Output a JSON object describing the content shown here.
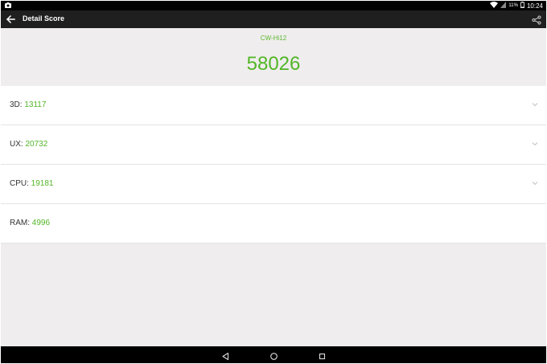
{
  "status_bar": {
    "battery_percent": "11%",
    "time": "10:24"
  },
  "app_bar": {
    "title": "Detail Score"
  },
  "header": {
    "device_name": "CW-Hi12",
    "total_score": "58026"
  },
  "scores": [
    {
      "label": "3D: ",
      "value": "13117",
      "expandable": true
    },
    {
      "label": "UX: ",
      "value": "20732",
      "expandable": true
    },
    {
      "label": "CPU: ",
      "value": "19181",
      "expandable": true
    },
    {
      "label": "RAM: ",
      "value": "4996",
      "expandable": false
    }
  ],
  "colors": {
    "accent": "#52b627",
    "app_bar": "#1f1f1f",
    "background": "#efeded"
  },
  "icons": {
    "back": "arrow-left-icon",
    "share": "share-icon",
    "chevron": "chevron-down-icon",
    "nav_back": "triangle-back-icon",
    "nav_home": "circle-home-icon",
    "nav_recents": "square-recents-icon"
  }
}
